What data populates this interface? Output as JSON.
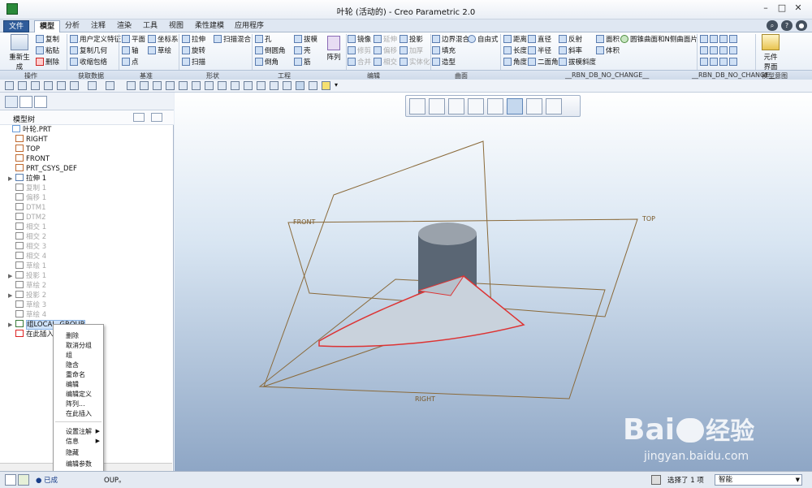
{
  "window": {
    "title": "叶轮 (活动的) - Creo Parametric 2.0"
  },
  "menu_tabs": [
    "文件",
    "模型",
    "分析",
    "注释",
    "渲染",
    "工具",
    "视图",
    "柔性建模",
    "应用程序"
  ],
  "ribbon": {
    "regen": "重新生成",
    "ops": [
      "复制",
      "粘贴",
      "删除"
    ],
    "getdata": [
      "用户定义特征",
      "复制几何",
      "收缩包络"
    ],
    "datum": [
      "平面",
      "轴",
      "点",
      "坐标系",
      "草绘"
    ],
    "shape": [
      "拉伸",
      "旋转",
      "扫描",
      "扫描混合"
    ],
    "eng": [
      "孔",
      "倒圆角",
      "倒角",
      "拔模",
      "壳",
      "筋"
    ],
    "pattern": "阵列",
    "edit": [
      "镜像",
      "延伸",
      "投影",
      "修剪",
      "偏移",
      "加厚",
      "合并",
      "相交",
      "实体化"
    ],
    "surfaces": [
      "边界混合",
      "自由式",
      "填充",
      "造型"
    ],
    "measure": [
      "距离",
      "直径",
      "长度",
      "半径",
      "角度",
      "二面角",
      "反射",
      "斜率",
      "拔模斜度",
      "面积",
      "体积",
      "圆锥曲面和N侧曲面片"
    ],
    "design": [
      "元件",
      "界面"
    ],
    "group_labels": [
      "操作",
      "获取数据",
      "基准",
      "形状",
      "工程",
      "编辑",
      "曲面",
      "__RBN_DB_NO_CHANGE__",
      "__RBN_DB_NO_CHANGE__",
      "模型意图"
    ]
  },
  "tree": {
    "header": "模型树",
    "nodes": [
      {
        "label": "叶轮.PRT",
        "dim": false,
        "exp": ""
      },
      {
        "label": "RIGHT",
        "dim": false,
        "exp": ""
      },
      {
        "label": "TOP",
        "dim": false,
        "exp": ""
      },
      {
        "label": "FRONT",
        "dim": false,
        "exp": ""
      },
      {
        "label": "PRT_CSYS_DEF",
        "dim": false,
        "exp": ""
      },
      {
        "label": "拉伸 1",
        "dim": false,
        "exp": "▶"
      },
      {
        "label": "复制 1",
        "dim": true,
        "exp": ""
      },
      {
        "label": "偏移 1",
        "dim": true,
        "exp": ""
      },
      {
        "label": "DTM1",
        "dim": true,
        "exp": ""
      },
      {
        "label": "DTM2",
        "dim": true,
        "exp": ""
      },
      {
        "label": "相交 1",
        "dim": true,
        "exp": ""
      },
      {
        "label": "相交 2",
        "dim": true,
        "exp": ""
      },
      {
        "label": "相交 3",
        "dim": true,
        "exp": ""
      },
      {
        "label": "相交 4",
        "dim": true,
        "exp": ""
      },
      {
        "label": "草绘 1",
        "dim": true,
        "exp": ""
      },
      {
        "label": "投影 1",
        "dim": true,
        "exp": "▶"
      },
      {
        "label": "草绘 2",
        "dim": true,
        "exp": ""
      },
      {
        "label": "投影 2",
        "dim": true,
        "exp": "▶"
      },
      {
        "label": "草绘 3",
        "dim": true,
        "exp": ""
      },
      {
        "label": "草绘 4",
        "dim": true,
        "exp": ""
      },
      {
        "label": "组LOCAL_GROUP",
        "dim": false,
        "exp": "▶",
        "sel": true
      },
      {
        "label": "在此插入",
        "dim": false,
        "exp": ""
      }
    ]
  },
  "context_menu": [
    "删除",
    "取消分组",
    "组",
    "隐含",
    "重命名",
    "编辑",
    "编辑定义",
    "阵列...",
    "在此插入",
    "设置注解",
    "信息",
    "隐藏",
    "编辑参数"
  ],
  "viewport": {
    "planes": [
      "FRONT",
      "TOP",
      "RIGHT"
    ]
  },
  "status": {
    "msg_prefix": "已成",
    "msg_suffix": "OUP。",
    "selected": "选择了 1 项",
    "filter": "智能"
  },
  "watermark": {
    "brand": "Bai",
    "brand2": "经验",
    "url": "jingyan.baidu.com"
  }
}
